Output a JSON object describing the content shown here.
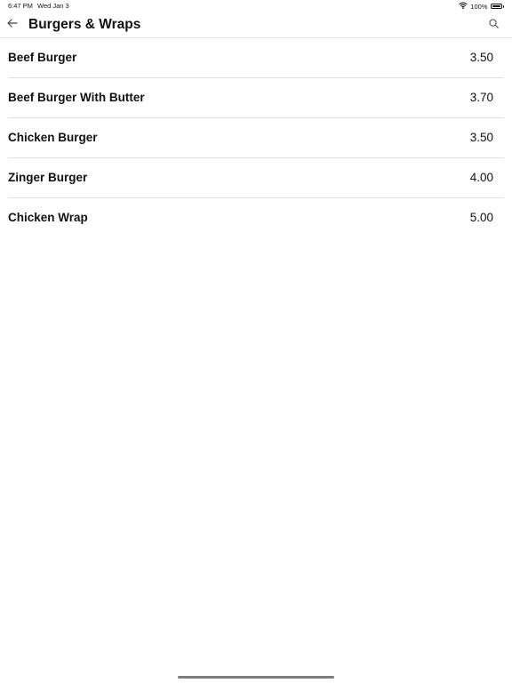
{
  "status_bar": {
    "time": "6:47 PM",
    "date": "Wed Jan 3",
    "battery": "100%",
    "wifi_icon": "wifi-icon",
    "battery_icon": "battery-icon"
  },
  "header": {
    "title": "Burgers & Wraps",
    "back_icon": "arrow-left-icon",
    "search_icon": "search-icon"
  },
  "menu": {
    "items": [
      {
        "name": "Beef Burger",
        "price": "3.50"
      },
      {
        "name": "Beef Burger With Butter",
        "price": "3.70"
      },
      {
        "name": "Chicken Burger",
        "price": "3.50"
      },
      {
        "name": "Zinger Burger",
        "price": "4.00"
      },
      {
        "name": "Chicken Wrap",
        "price": "5.00"
      }
    ]
  },
  "colors": {
    "text": "#111111",
    "divider": "#dedede",
    "background": "#ffffff"
  }
}
